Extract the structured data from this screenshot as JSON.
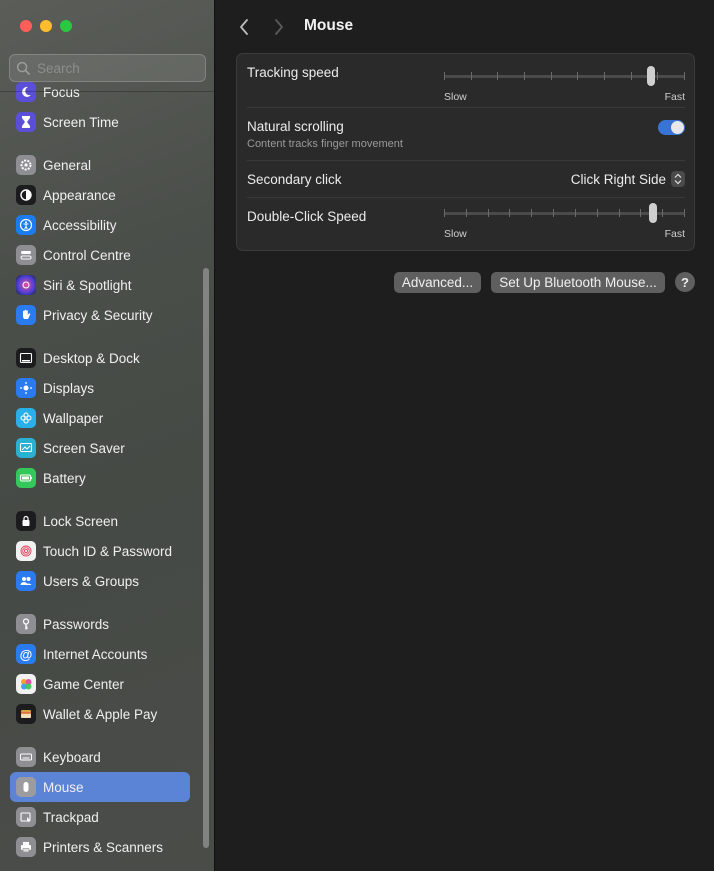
{
  "window": {
    "title": "Mouse"
  },
  "search": {
    "placeholder": "Search"
  },
  "sidebar": {
    "items": [
      {
        "label": "Focus",
        "icon": "moon-icon",
        "color": "#5a4fd6"
      },
      {
        "label": "Screen Time",
        "icon": "hourglass-icon",
        "color": "#5a4fd6"
      },
      {
        "label": "General",
        "icon": "gear-icon",
        "color": "#8e8e93"
      },
      {
        "label": "Appearance",
        "icon": "appearance-icon",
        "color": "#1c1c1e"
      },
      {
        "label": "Accessibility",
        "icon": "accessibility-icon",
        "color": "#1a7cf0"
      },
      {
        "label": "Control Centre",
        "icon": "control-centre-icon",
        "color": "#8e8e93"
      },
      {
        "label": "Siri & Spotlight",
        "icon": "siri-icon",
        "color": "#6b3fd6"
      },
      {
        "label": "Privacy & Security",
        "icon": "hand-icon",
        "color": "#2a7bf0"
      },
      {
        "label": "Desktop & Dock",
        "icon": "dock-icon",
        "color": "#1c1c1e"
      },
      {
        "label": "Displays",
        "icon": "sun-icon",
        "color": "#2a7bf0"
      },
      {
        "label": "Wallpaper",
        "icon": "flower-icon",
        "color": "#2ab0e8"
      },
      {
        "label": "Screen Saver",
        "icon": "screen-saver-icon",
        "color": "#2ab0d0"
      },
      {
        "label": "Battery",
        "icon": "battery-icon",
        "color": "#34c759"
      },
      {
        "label": "Lock Screen",
        "icon": "lock-icon",
        "color": "#1c1c1e"
      },
      {
        "label": "Touch ID & Password",
        "icon": "fingerprint-icon",
        "color": "#f2f2f2"
      },
      {
        "label": "Users & Groups",
        "icon": "users-icon",
        "color": "#2a7bf0"
      },
      {
        "label": "Passwords",
        "icon": "key-icon",
        "color": "#8e8e93"
      },
      {
        "label": "Internet Accounts",
        "icon": "at-icon",
        "color": "#2a7bf0"
      },
      {
        "label": "Game Center",
        "icon": "game-center-icon",
        "color": "#f2f2f2"
      },
      {
        "label": "Wallet & Apple Pay",
        "icon": "wallet-icon",
        "color": "#1c1c1e"
      },
      {
        "label": "Keyboard",
        "icon": "keyboard-icon",
        "color": "#8e8e93"
      },
      {
        "label": "Mouse",
        "icon": "mouse-icon",
        "color": "#8e8e93"
      },
      {
        "label": "Trackpad",
        "icon": "trackpad-icon",
        "color": "#8e8e93"
      },
      {
        "label": "Printers & Scanners",
        "icon": "printer-icon",
        "color": "#8e8e93"
      }
    ],
    "selected": "Mouse",
    "accent": "#5b84d6"
  },
  "settings": {
    "tracking_speed": {
      "label": "Tracking speed",
      "min_label": "Slow",
      "max_label": "Fast",
      "ticks": 10,
      "value_fraction": 0.87
    },
    "natural_scrolling": {
      "label": "Natural scrolling",
      "sublabel": "Content tracks finger movement",
      "enabled": true
    },
    "secondary_click": {
      "label": "Secondary click",
      "value": "Click Right Side"
    },
    "double_click_speed": {
      "label": "Double-Click Speed",
      "min_label": "Slow",
      "max_label": "Fast",
      "ticks": 12,
      "value_fraction": 0.88
    }
  },
  "buttons": {
    "advanced": "Advanced...",
    "bluetooth": "Set Up Bluetooth Mouse...",
    "help": "?"
  }
}
